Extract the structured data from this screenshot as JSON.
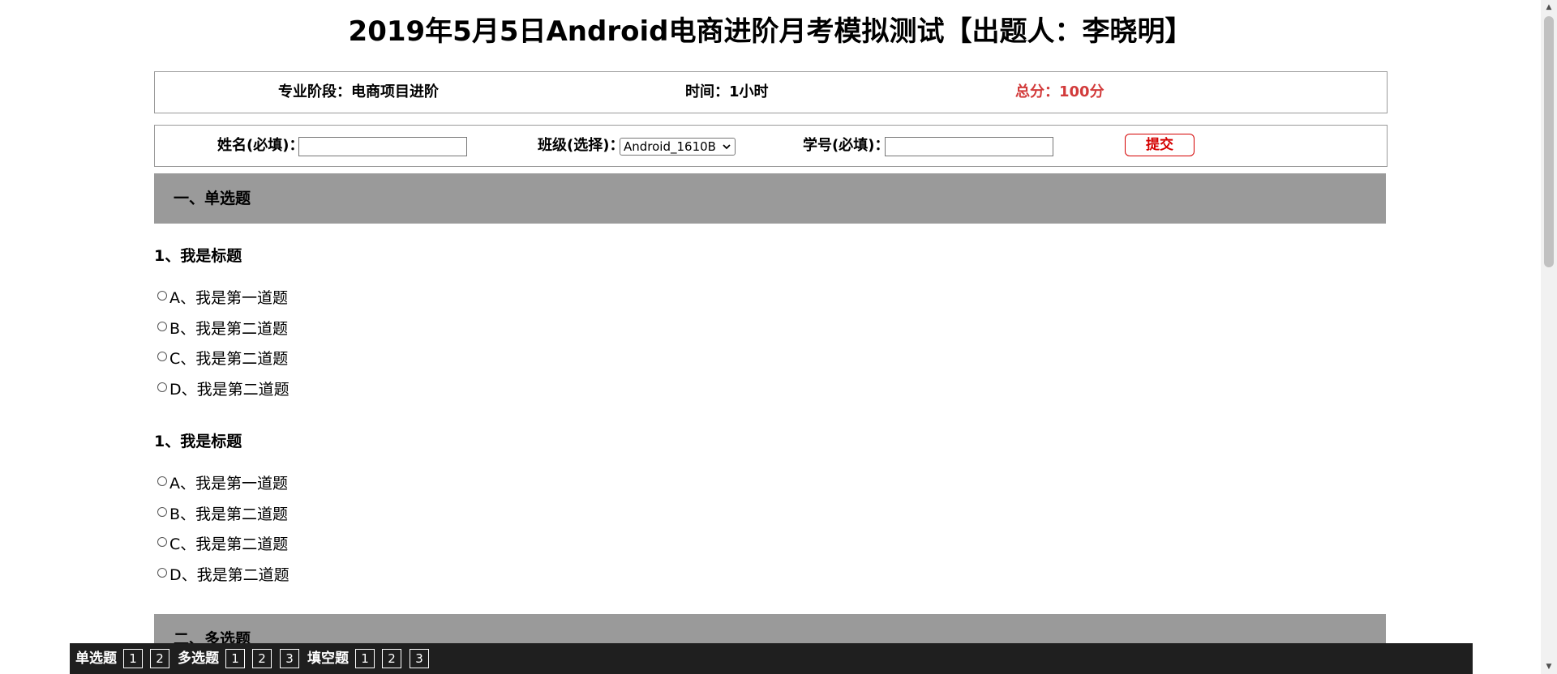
{
  "title": "2019年5月5日Android电商进阶月考模拟测试【出题人：李晓明】",
  "info": {
    "stage": "专业阶段：电商项目进阶",
    "time": "时间：1小时",
    "total": "总分：100分",
    "total_color": "#d23b3b"
  },
  "form": {
    "name_label": "姓名(必填)：",
    "name_value": "",
    "class_label": "班级(选择)：",
    "class_selected": "Android_1610B",
    "id_label": "学号(必填)：",
    "id_value": "",
    "submit_label": "提交"
  },
  "sections": [
    {
      "heading": "一、单选题"
    },
    {
      "heading": "二、多选题"
    }
  ],
  "questions": [
    {
      "title": "1、我是标题",
      "options": [
        "A、我是第一道题",
        "B、我是第二道题",
        "C、我是第二道题",
        "D、我是第二道题"
      ]
    },
    {
      "title": "1、我是标题",
      "options": [
        "A、我是第一道题",
        "B、我是第二道题",
        "C、我是第二道题",
        "D、我是第二道题"
      ]
    }
  ],
  "nav": {
    "single_label": "单选题",
    "single_items": [
      "1",
      "2"
    ],
    "multi_label": "多选题",
    "multi_items": [
      "1",
      "2",
      "3"
    ],
    "fill_label": "填空题",
    "fill_items": [
      "1",
      "2",
      "3"
    ]
  },
  "icons": {
    "radio": "radio-unchecked-icon",
    "select": "chevron-down-icon",
    "scroll_up": "triangle-up-icon",
    "scroll_down": "triangle-down-icon"
  },
  "colors": {
    "section_bg": "#9a9a9a",
    "nav_bg": "#1f1f1f",
    "submit": "#d40000"
  }
}
